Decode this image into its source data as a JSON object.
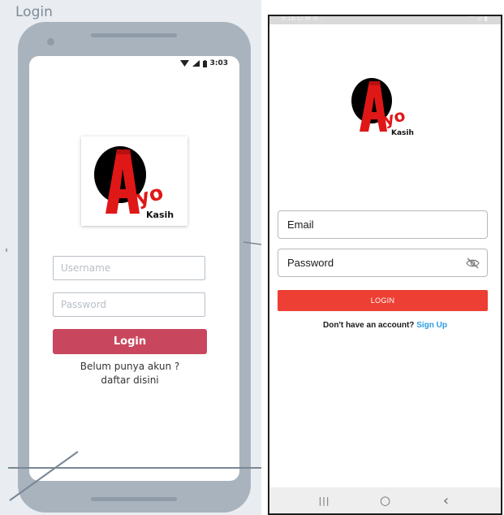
{
  "wireframe": {
    "frame_title": "Login",
    "status_time": "3:03",
    "username_placeholder": "Username",
    "password_placeholder": "Password",
    "login_label": "Login",
    "register_line1": "Belum punya akun ?",
    "register_line2": "daftar disini"
  },
  "app": {
    "status_time": "9:16 LI M ⊙ ·",
    "status_icons": "⌔ .ıl ▮",
    "email_placeholder": "Email",
    "password_placeholder": "Password",
    "login_label": "LOGIN",
    "no_account_text": "Don't have an account?",
    "signup_link": "Sign Up",
    "navbar": {
      "recent_glyph": "|||",
      "home_glyph": "○",
      "back_glyph": "‹"
    }
  },
  "brand": {
    "logo_letter": "A",
    "logo_word": "yo",
    "logo_sub": "Kasih"
  },
  "colors": {
    "wireframe_login": "#c9475e",
    "app_login": "#ed3f33",
    "signup_link": "#2a9de4",
    "logo_red": "#e01717"
  }
}
